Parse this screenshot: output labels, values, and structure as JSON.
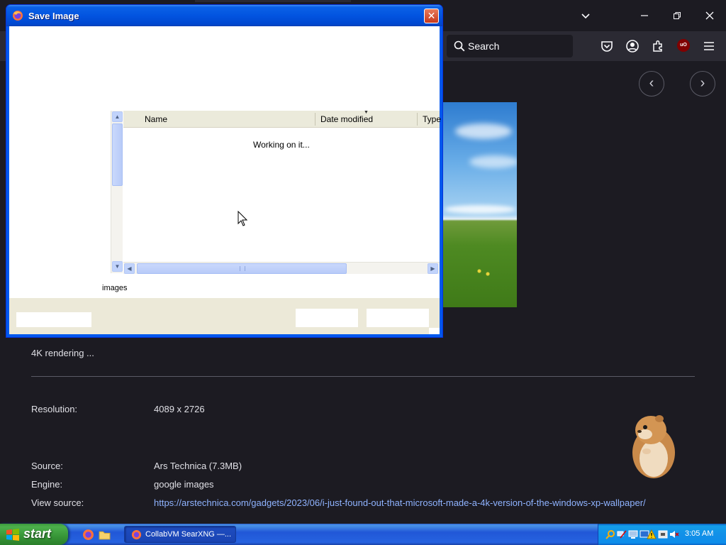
{
  "browser": {
    "search_placeholder": "Search",
    "window_controls": [
      "chevron-down",
      "minimize",
      "restore",
      "close"
    ]
  },
  "page": {
    "description": "4K rendering ...",
    "details": [
      {
        "label": "Resolution:",
        "value": "4089 x 2726"
      },
      {
        "label": "Source:",
        "value": "Ars Technica (7.3MB)"
      },
      {
        "label": "Engine:",
        "value": "google images"
      },
      {
        "label": "View source:",
        "value": "https://arstechnica.com/gadgets/2023/06/i-just-found-out-that-microsoft-made-a-4k-version-of-the-windows-xp-wallpaper/"
      }
    ]
  },
  "dialog": {
    "title": "Save Image",
    "close_label": "✕",
    "columns": [
      "Name",
      "Date modified",
      "Type"
    ],
    "status_text": "Working on it...",
    "folder_label": "images"
  },
  "taskbar": {
    "start_label": "start",
    "tasks": [
      {
        "label": "CollabVM SearXNG —..."
      }
    ],
    "clock": "3:05 AM"
  },
  "colors": {
    "xp_blue": "#0058ee",
    "firefox_dark": "#1c1b22",
    "link": "#8fb3ff",
    "start_green": "#3c9a3c"
  }
}
